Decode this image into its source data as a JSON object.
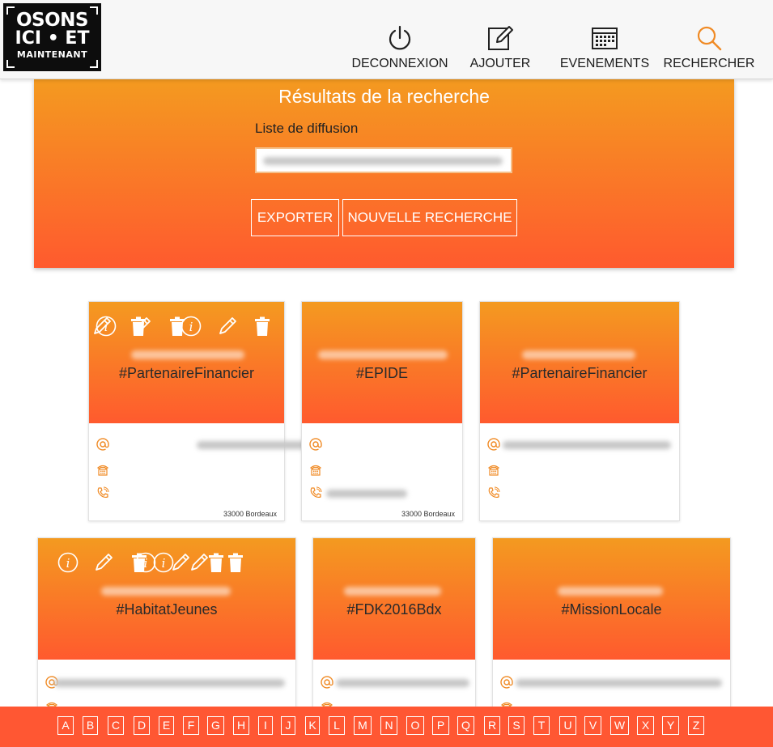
{
  "header": {
    "logo": {
      "line1": "OSONS",
      "line2": "ICI • ET",
      "line3": "MAINTENANT"
    },
    "nav": [
      {
        "label": "DECONNEXION",
        "icon": "power-icon"
      },
      {
        "label": "AJOUTER",
        "icon": "edit-icon"
      },
      {
        "label": "EVENEMENTS",
        "icon": "calendar-icon"
      },
      {
        "label": "RECHERCHER",
        "icon": "search-icon"
      }
    ]
  },
  "search": {
    "title": "Résultats de la recherche",
    "field_label": "Liste de diffusion",
    "field_value": "",
    "export_label": "EXPORTER",
    "new_search_label": "NOUVELLE RECHERCHE"
  },
  "cards": [
    {
      "tag": "#PartenaireFinancier",
      "city": "33000 Bordeaux"
    },
    {
      "tag": "#EPIDE",
      "city": "33000 Bordeaux"
    },
    {
      "tag": "#PartenaireFinancier",
      "city": ""
    },
    {
      "tag": "#HabitatJeunes",
      "city": ""
    },
    {
      "tag": "#FDK2016Bdx",
      "city": ""
    },
    {
      "tag": "#MissionLocale",
      "city": ""
    }
  ],
  "alphabet": [
    "A",
    "B",
    "C",
    "D",
    "E",
    "F",
    "G",
    "H",
    "I",
    "J",
    "K",
    "L",
    "M",
    "N",
    "O",
    "P",
    "Q",
    "R",
    "S",
    "T",
    "U",
    "V",
    "W",
    "X",
    "Y",
    "Z"
  ],
  "colors": {
    "accent": "#ff5733",
    "gradient_top": "#f49a20",
    "gradient_bottom": "#ff5a2e",
    "icon_orange": "#f08a24"
  }
}
